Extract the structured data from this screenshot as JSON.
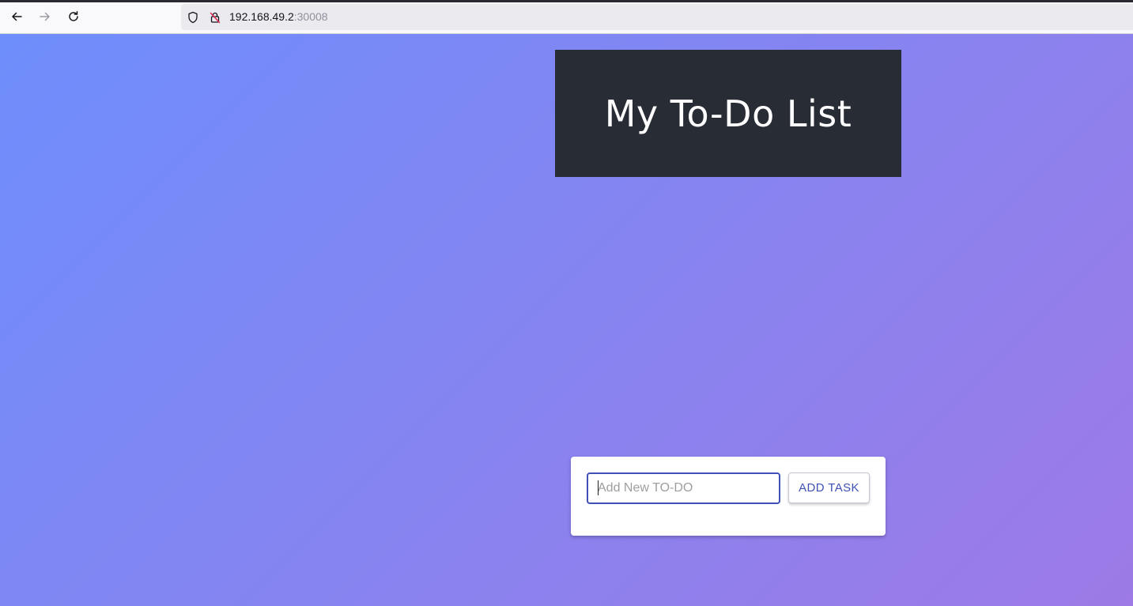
{
  "browser": {
    "url_host": "192.168.49.2",
    "url_port": ":30008",
    "icons": [
      "back-arrow-icon",
      "forward-arrow-icon",
      "reload-icon",
      "shield-icon",
      "insecure-lock-icon"
    ]
  },
  "app": {
    "title": "My To-Do List",
    "input_value": "",
    "input_placeholder": "Add New TO-DO",
    "add_button_label": "ADD TASK"
  },
  "colors": {
    "header_bg": "#282c34",
    "gradient_start": "#6e8efb",
    "gradient_end": "#9d7ae6",
    "accent": "#3f51b5"
  }
}
